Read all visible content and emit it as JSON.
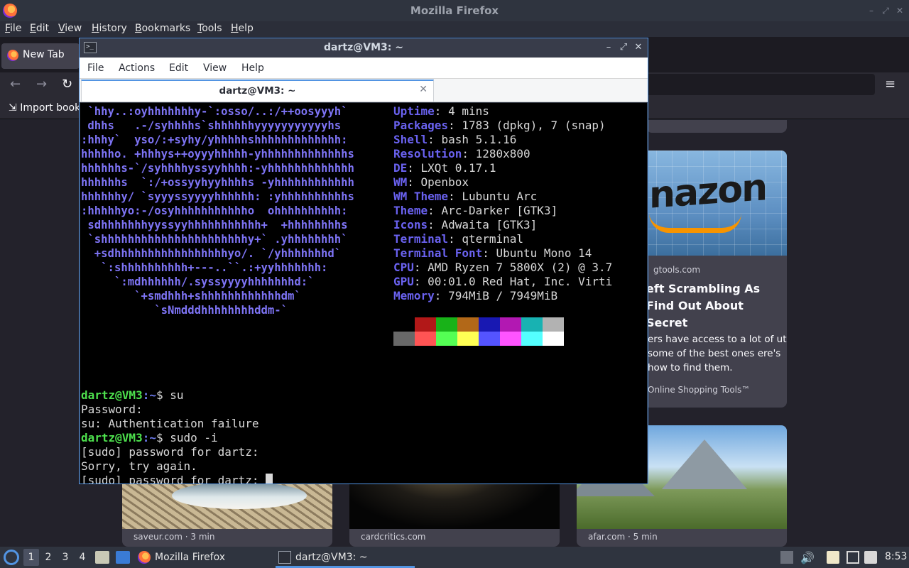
{
  "firefox": {
    "window_title": "Mozilla Firefox",
    "menu": [
      "File",
      "Edit",
      "View",
      "History",
      "Bookmarks",
      "Tools",
      "Help"
    ],
    "tab_label": "New Tab",
    "bookmark_item": "Import book",
    "cards": {
      "amazon": {
        "source": "gtools.com",
        "headline": "eft Scrambling As Find Out About Secret",
        "description": "ers have access to a lot of ut some of the best ones ere's how to find them.",
        "sponsor": "Online Shopping Tools™",
        "image_word": "nazon"
      },
      "fish_source": "saveur.com · 3 min",
      "dark_source": "cardcritics.com",
      "mountain_source": "afar.com · 5 min"
    }
  },
  "terminal": {
    "window_title": "dartz@VM3: ~",
    "menu": [
      "File",
      "Actions",
      "Edit",
      "View",
      "Help"
    ],
    "tab_label": "dartz@VM3: ~",
    "ascii_logo": [
      " `hhy..:oyhhhhhhhy-`:osso/..:/++oosyyyh`",
      " dhhs   .-/syhhhhs`shhhhhhyyyyyyyyyyyhs",
      ":hhhy`  yso/:+syhy/yhhhhhshhhhhhhhhhhhh:",
      "hhhhho. +hhhys++oyyyhhhhh-yhhhhhhhhhhhhhs",
      "hhhhhhs-`/syhhhhyssyyhhhh:-yhhhhhhhhhhhhh",
      "hhhhhhs  `:/+ossyyhyyhhhhs -yhhhhhhhhhhhh",
      "hhhhhhy/ `syyyssyyyyhhhhhh: :yhhhhhhhhhhs",
      ":hhhhhyo:-/osyhhhhhhhhhhho  ohhhhhhhhhh:",
      " sdhhhhhhhyyssyyhhhhhhhhhhh+  +hhhhhhhhs",
      " `shhhhhhhhhhhhhhhhhhhhhhy+` .yhhhhhhhh`",
      "  +sdhhhhhhhhhhhhhhhhhyo/. `/yhhhhhhhd`",
      "   `:shhhhhhhhhh+---..``.:+yyhhhhhhh:",
      "     `:mdhhhhhh/.syssyyyyhhhhhhhd:`",
      "        `+smdhhh+shhhhhhhhhhhhdm`",
      "           `sNmdddhhhhhhhhddm-`"
    ],
    "info": [
      {
        "key": "Uptime",
        "value": "4 mins"
      },
      {
        "key": "Packages",
        "value": "1783 (dpkg), 7 (snap)"
      },
      {
        "key": "Shell",
        "value": "bash 5.1.16"
      },
      {
        "key": "Resolution",
        "value": "1280x800"
      },
      {
        "key": "DE",
        "value": "LXQt 0.17.1"
      },
      {
        "key": "WM",
        "value": "Openbox"
      },
      {
        "key": "WM Theme",
        "value": "Lubuntu Arc"
      },
      {
        "key": "Theme",
        "value": "Arc-Darker [GTK3]"
      },
      {
        "key": "Icons",
        "value": "Adwaita [GTK3]"
      },
      {
        "key": "Terminal",
        "value": "qterminal"
      },
      {
        "key": "Terminal Font",
        "value": "Ubuntu Mono 14"
      },
      {
        "key": "CPU",
        "value": "AMD Ryzen 7 5800X (2) @ 3.7"
      },
      {
        "key": "GPU",
        "value": "00:01.0 Red Hat, Inc. Virti"
      },
      {
        "key": "Memory",
        "value": "794MiB / 7949MiB"
      }
    ],
    "palette_top": [
      "#000000",
      "#b21818",
      "#18b218",
      "#b26818",
      "#1818b2",
      "#b218b2",
      "#18b2b2",
      "#b2b2b2"
    ],
    "palette_bottom": [
      "#686868",
      "#ff5454",
      "#54ff54",
      "#ffff54",
      "#5454ff",
      "#ff54ff",
      "#54ffff",
      "#ffffff"
    ],
    "prompt_user": "dartz@VM3",
    "prompt_path": ":~",
    "prompt_symbol": "$ ",
    "session": {
      "cmd1": "su",
      "line_password": "Password:",
      "line_auth_fail": "su: Authentication failure",
      "cmd2": "sudo -i",
      "line_sudo1": "[sudo] password for dartz:",
      "line_sorry": "Sorry, try again.",
      "line_sudo2": "[sudo] password for dartz: "
    }
  },
  "taskbar": {
    "desktops": [
      "1",
      "2",
      "3",
      "4"
    ],
    "tasks": [
      "Mozilla Firefox",
      "dartz@VM3: ~"
    ],
    "clock": "8:53"
  }
}
